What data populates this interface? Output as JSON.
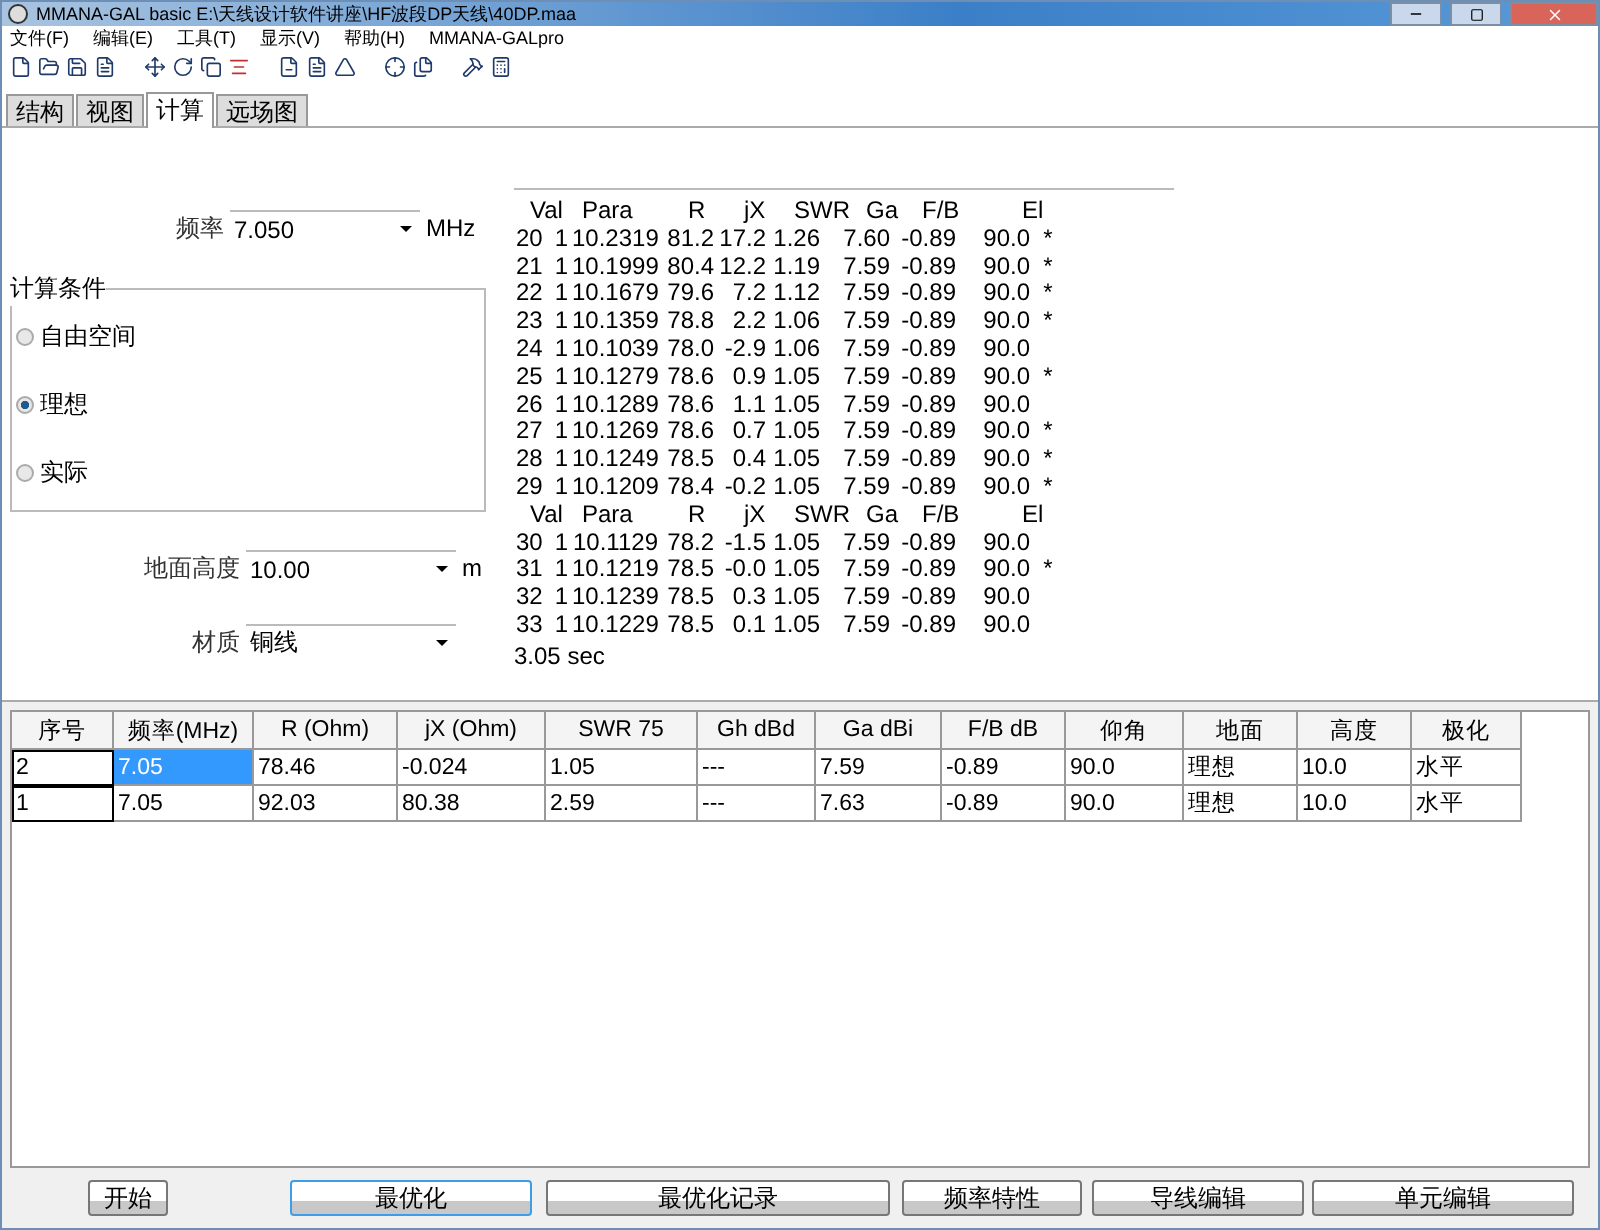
{
  "window": {
    "title": "MMANA-GAL basic  E:\\天线设计软件讲座\\HF波段DP天线\\40DP.maa"
  },
  "menu": [
    "文件(F)",
    "编辑(E)",
    "工具(T)",
    "显示(V)",
    "帮助(H)",
    "MMANA-GALpro"
  ],
  "tabs": [
    {
      "label": "结构",
      "selected": false
    },
    {
      "label": "视图",
      "selected": false
    },
    {
      "label": "计算",
      "selected": true
    },
    {
      "label": "远场图",
      "selected": false
    }
  ],
  "frequency": {
    "label": "频率",
    "value": "7.050",
    "unit": "MHz"
  },
  "conditions": {
    "title": "计算条件",
    "options": [
      {
        "label": "自由空间",
        "selected": false
      },
      {
        "label": "理想",
        "selected": true
      },
      {
        "label": "实际",
        "selected": false
      }
    ]
  },
  "height": {
    "label": "地面高度",
    "value": "10.00",
    "unit": "m"
  },
  "material": {
    "label": "材质",
    "value": "铜线"
  },
  "output": {
    "lines": [
      {
        "kind": "header",
        "cells": [
          "Val",
          "Para",
          "R",
          "jX",
          "SWR",
          "Ga",
          "F/B",
          "El"
        ]
      },
      {
        "kind": "row",
        "cells": [
          "20",
          "1",
          "10.2319",
          "81.2",
          "17.2",
          "1.26",
          "7.60",
          "-0.89",
          "90.0",
          "*"
        ]
      },
      {
        "kind": "row",
        "cells": [
          "21",
          "1",
          "10.1999",
          "80.4",
          "12.2",
          "1.19",
          "7.59",
          "-0.89",
          "90.0",
          "*"
        ]
      },
      {
        "kind": "row",
        "cells": [
          "22",
          "1",
          "10.1679",
          "79.6",
          "7.2",
          "1.12",
          "7.59",
          "-0.89",
          "90.0",
          "*"
        ]
      },
      {
        "kind": "row",
        "cells": [
          "23",
          "1",
          "10.1359",
          "78.8",
          "2.2",
          "1.06",
          "7.59",
          "-0.89",
          "90.0",
          "*"
        ]
      },
      {
        "kind": "row",
        "cells": [
          "24",
          "1",
          "10.1039",
          "78.0",
          "-2.9",
          "1.06",
          "7.59",
          "-0.89",
          "90.0"
        ]
      },
      {
        "kind": "row",
        "cells": [
          "25",
          "1",
          "10.1279",
          "78.6",
          "0.9",
          "1.05",
          "7.59",
          "-0.89",
          "90.0",
          "*"
        ]
      },
      {
        "kind": "row",
        "cells": [
          "26",
          "1",
          "10.1289",
          "78.6",
          "1.1",
          "1.05",
          "7.59",
          "-0.89",
          "90.0"
        ]
      },
      {
        "kind": "row",
        "cells": [
          "27",
          "1",
          "10.1269",
          "78.6",
          "0.7",
          "1.05",
          "7.59",
          "-0.89",
          "90.0",
          "*"
        ]
      },
      {
        "kind": "row",
        "cells": [
          "28",
          "1",
          "10.1249",
          "78.5",
          "0.4",
          "1.05",
          "7.59",
          "-0.89",
          "90.0",
          "*"
        ]
      },
      {
        "kind": "row",
        "cells": [
          "29",
          "1",
          "10.1209",
          "78.4",
          "-0.2",
          "1.05",
          "7.59",
          "-0.89",
          "90.0",
          "*"
        ]
      },
      {
        "kind": "header",
        "cells": [
          "Val",
          "Para",
          "R",
          "jX",
          "SWR",
          "Ga",
          "F/B",
          "El"
        ]
      },
      {
        "kind": "row",
        "cells": [
          "30",
          "1",
          "10.1129",
          "78.2",
          "-1.5",
          "1.05",
          "7.59",
          "-0.89",
          "90.0"
        ]
      },
      {
        "kind": "row",
        "cells": [
          "31",
          "1",
          "10.1219",
          "78.5",
          "-0.0",
          "1.05",
          "7.59",
          "-0.89",
          "90.0",
          "*"
        ]
      },
      {
        "kind": "row",
        "cells": [
          "32",
          "1",
          "10.1239",
          "78.5",
          "0.3",
          "1.05",
          "7.59",
          "-0.89",
          "90.0"
        ]
      },
      {
        "kind": "row",
        "cells": [
          "33",
          "1",
          "10.1229",
          "78.5",
          "0.1",
          "1.05",
          "7.59",
          "-0.89",
          "90.0"
        ]
      }
    ],
    "time": "3.05 sec"
  },
  "table": {
    "columns": [
      "序号",
      "频率(MHz)",
      "R (Ohm)",
      "jX (Ohm)",
      "SWR 75",
      "Gh dBd",
      "Ga dBi",
      "F/B dB",
      "仰角",
      "地面",
      "高度",
      "极化"
    ],
    "rows": [
      {
        "selected": true,
        "cells": [
          "2",
          "7.05",
          "78.46",
          "-0.024",
          "1.05",
          "---",
          "7.59",
          "-0.89",
          "90.0",
          "理想",
          "10.0",
          "水平"
        ]
      },
      {
        "selected": false,
        "cells": [
          "1",
          "7.05",
          "92.03",
          "80.38",
          "2.59",
          "---",
          "7.63",
          "-0.89",
          "90.0",
          "理想",
          "10.0",
          "水平"
        ]
      }
    ]
  },
  "buttons": [
    {
      "label": "开始",
      "focused": false
    },
    {
      "label": "最优化",
      "focused": true
    },
    {
      "label": "最优化记录",
      "focused": false
    },
    {
      "label": "频率特性",
      "focused": false
    },
    {
      "label": "导线编辑",
      "focused": false
    },
    {
      "label": "单元编辑",
      "focused": false
    }
  ]
}
